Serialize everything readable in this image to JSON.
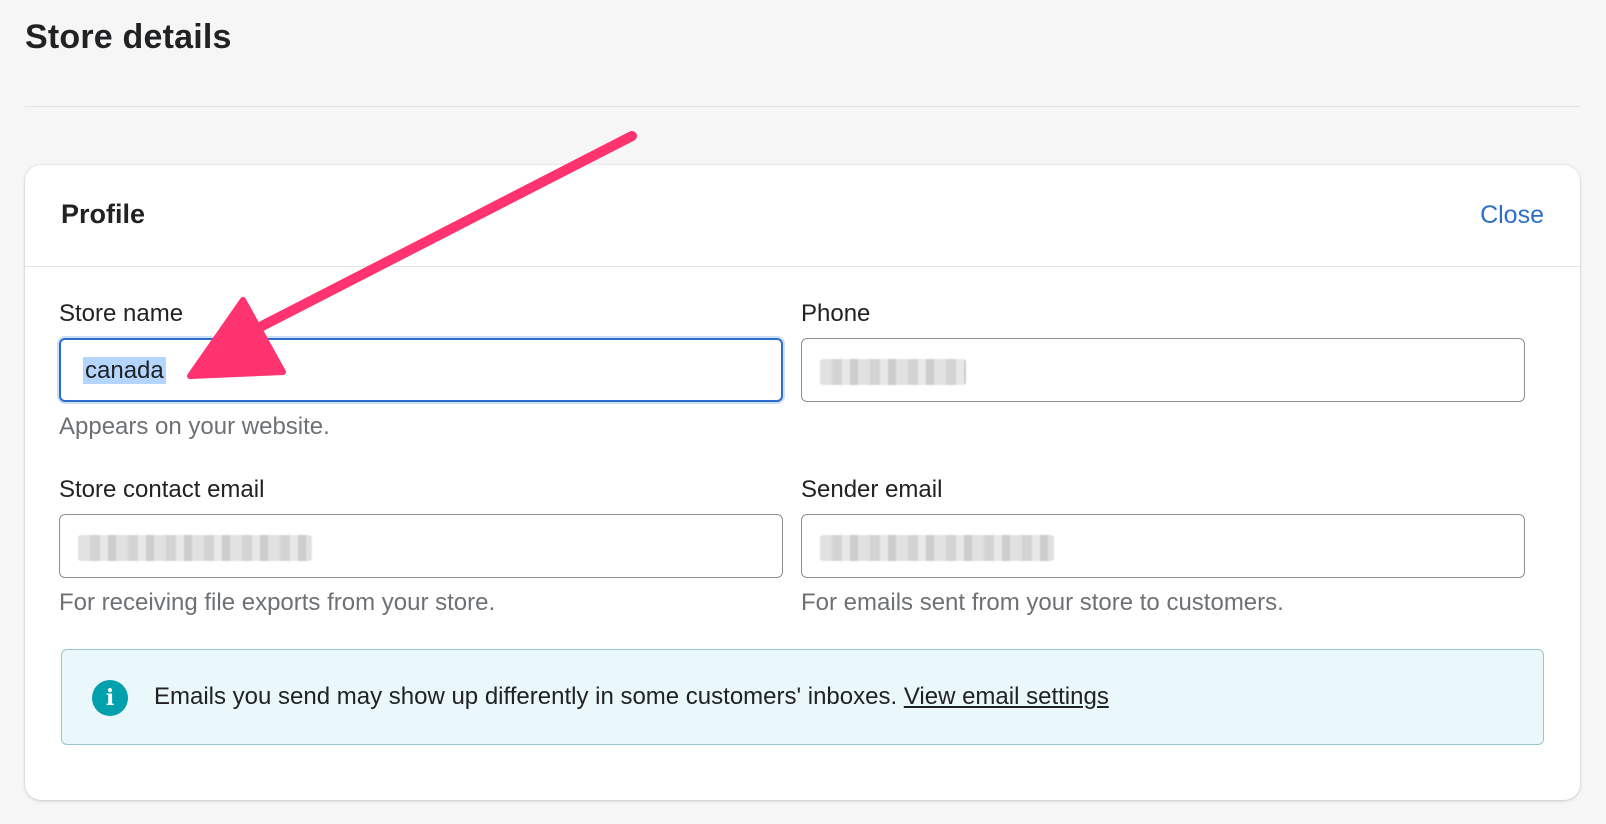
{
  "page": {
    "title": "Store details"
  },
  "profile": {
    "title": "Profile",
    "close_label": "Close",
    "fields": {
      "store_name": {
        "label": "Store name",
        "value": "canada",
        "help": "Appears on your website."
      },
      "phone": {
        "label": "Phone",
        "value_redacted": true
      },
      "store_contact_email": {
        "label": "Store contact email",
        "value_redacted": true,
        "help": "For receiving file exports from your store."
      },
      "sender_email": {
        "label": "Sender email",
        "value_redacted": true,
        "help": "For emails sent from your store to customers."
      }
    },
    "banner": {
      "text": "Emails you send may show up differently in some customers' inboxes.",
      "link_label": "View email settings"
    }
  },
  "annotation": {
    "arrow_color": "#ff3370"
  },
  "colors": {
    "link": "#2c6ecb",
    "focus": "#2c6ecb",
    "banner_bg": "#eaf7fb",
    "info_icon": "#00a0ac"
  }
}
